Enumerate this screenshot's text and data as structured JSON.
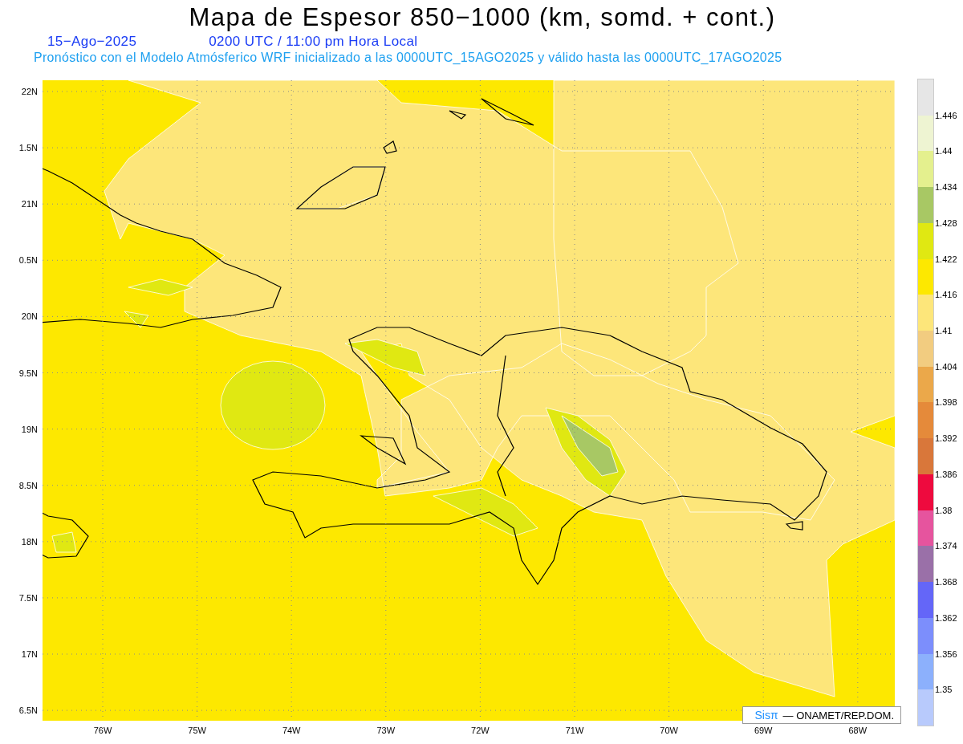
{
  "title": "Mapa de Espesor 850−1000 (km, somd. + cont.)",
  "date": "15−Ago−2025",
  "time": "0200 UTC / 11:00 pm Hora Local",
  "forecast_note": "Pronóstico con el Modelo Atmósferico WRF inicializado a las 0000UTC_15AGO2025 y válido hasta las  0000UTC_17AGO2025",
  "y_axis_labels": [
    "22N",
    "1.5N",
    "21N",
    "0.5N",
    "20N",
    "9.5N",
    "19N",
    "8.5N",
    "18N",
    "7.5N",
    "17N",
    "6.5N"
  ],
  "x_axis_labels": [
    "76W",
    "75W",
    "74W",
    "73W",
    "72W",
    "71W",
    "70W",
    "69W",
    "68W"
  ],
  "credit": {
    "brand": "Sisπ",
    "text": "— ONAMET/REP.DOM."
  },
  "colorbar": [
    {
      "color": "#e6e6e6",
      "label": "1.446"
    },
    {
      "color": "#eef4d2",
      "label": "1.44"
    },
    {
      "color": "#e4f08e",
      "label": "1.434"
    },
    {
      "color": "#a8c864",
      "label": "1.428"
    },
    {
      "color": "#e0e812",
      "label": "1.422"
    },
    {
      "color": "#fde800",
      "label": "1.416"
    },
    {
      "color": "#fde67a",
      "label": "1.41"
    },
    {
      "color": "#f2cc80",
      "label": "1.404"
    },
    {
      "color": "#eba84a",
      "label": "1.398"
    },
    {
      "color": "#e58a3a",
      "label": "1.392"
    },
    {
      "color": "#d9773a",
      "label": "1.386"
    },
    {
      "color": "#ee0a3e",
      "label": "1.38"
    },
    {
      "color": "#e6549e",
      "label": "1.374"
    },
    {
      "color": "#9a70a8",
      "label": "1.368"
    },
    {
      "color": "#6466f8",
      "label": "1.362"
    },
    {
      "color": "#7c8efc",
      "label": "1.356"
    },
    {
      "color": "#8cb0fc",
      "label": "1.35"
    },
    {
      "color": "#b8cafc"
    }
  ]
}
